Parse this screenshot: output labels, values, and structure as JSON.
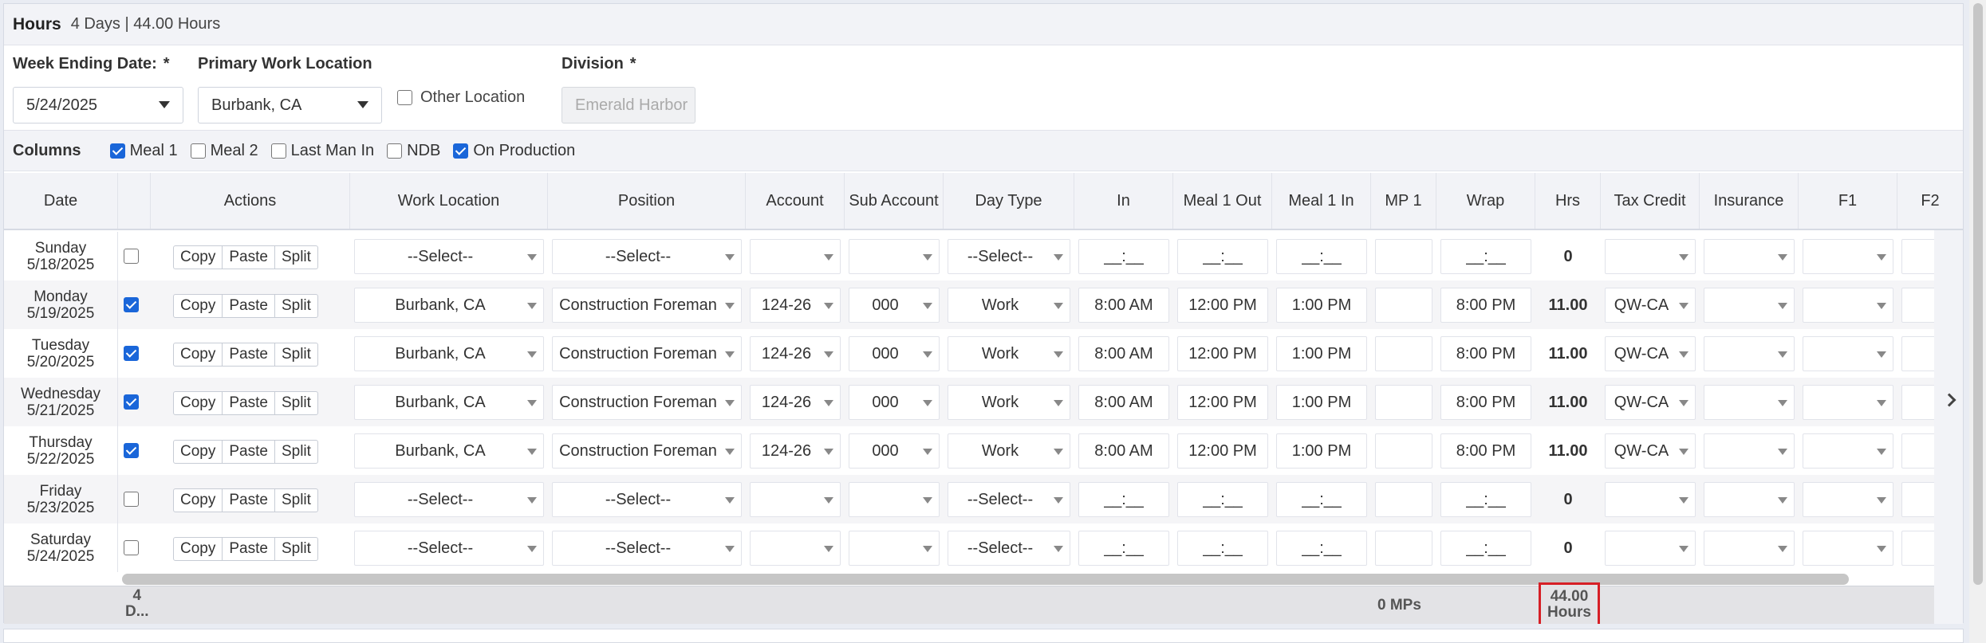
{
  "header": {
    "title": "Hours",
    "summary": "4 Days | 44.00 Hours"
  },
  "filters": {
    "week_ending_label": "Week Ending Date:",
    "week_ending_value": "5/24/2025",
    "primary_location_label": "Primary Work Location",
    "primary_location_value": "Burbank, CA",
    "other_location_label": "Other Location",
    "division_label": "Division",
    "division_value": "Emerald Harbor",
    "required_marker": "*"
  },
  "columns_bar": {
    "title": "Columns",
    "toggles": [
      {
        "label": "Meal 1",
        "checked": true
      },
      {
        "label": "Meal 2",
        "checked": false
      },
      {
        "label": "Last Man In",
        "checked": false
      },
      {
        "label": "NDB",
        "checked": false
      },
      {
        "label": "On Production",
        "checked": true
      }
    ]
  },
  "grid": {
    "headers": [
      "Date",
      "",
      "Actions",
      "Work Location",
      "Position",
      "Account",
      "Sub Account",
      "Day Type",
      "In",
      "Meal 1 Out",
      "Meal 1 In",
      "MP 1",
      "Wrap",
      "Hrs",
      "Tax Credit",
      "Insurance",
      "F1",
      "F2"
    ],
    "buttons": {
      "copy": "Copy",
      "paste": "Paste",
      "split": "Split"
    },
    "rows": [
      {
        "day": "Sunday",
        "date": "5/18/2025",
        "selected": false,
        "location": "--Select--",
        "position": "--Select--",
        "account": "",
        "sub_account": "",
        "day_type": "--Select--",
        "in": "__:__",
        "meal_out": "__:__",
        "meal_in": "__:__",
        "wrap": "__:__",
        "hrs": "0",
        "tax_credit": ""
      },
      {
        "day": "Monday",
        "date": "5/19/2025",
        "selected": true,
        "location": "Burbank, CA",
        "position": "Construction Foreman",
        "account": "124-26",
        "sub_account": "000",
        "day_type": "Work",
        "in": "8:00 AM",
        "meal_out": "12:00 PM",
        "meal_in": "1:00 PM",
        "wrap": "8:00 PM",
        "hrs": "11.00",
        "tax_credit": "QW-CA"
      },
      {
        "day": "Tuesday",
        "date": "5/20/2025",
        "selected": true,
        "location": "Burbank, CA",
        "position": "Construction Foreman",
        "account": "124-26",
        "sub_account": "000",
        "day_type": "Work",
        "in": "8:00 AM",
        "meal_out": "12:00 PM",
        "meal_in": "1:00 PM",
        "wrap": "8:00 PM",
        "hrs": "11.00",
        "tax_credit": "QW-CA"
      },
      {
        "day": "Wednesday",
        "date": "5/21/2025",
        "selected": true,
        "location": "Burbank, CA",
        "position": "Construction Foreman",
        "account": "124-26",
        "sub_account": "000",
        "day_type": "Work",
        "in": "8:00 AM",
        "meal_out": "12:00 PM",
        "meal_in": "1:00 PM",
        "wrap": "8:00 PM",
        "hrs": "11.00",
        "tax_credit": "QW-CA"
      },
      {
        "day": "Thursday",
        "date": "5/22/2025",
        "selected": true,
        "location": "Burbank, CA",
        "position": "Construction Foreman",
        "account": "124-26",
        "sub_account": "000",
        "day_type": "Work",
        "in": "8:00 AM",
        "meal_out": "12:00 PM",
        "meal_in": "1:00 PM",
        "wrap": "8:00 PM",
        "hrs": "11.00",
        "tax_credit": "QW-CA"
      },
      {
        "day": "Friday",
        "date": "5/23/2025",
        "selected": false,
        "location": "--Select--",
        "position": "--Select--",
        "account": "",
        "sub_account": "",
        "day_type": "--Select--",
        "in": "__:__",
        "meal_out": "__:__",
        "meal_in": "__:__",
        "wrap": "__:__",
        "hrs": "0",
        "tax_credit": ""
      },
      {
        "day": "Saturday",
        "date": "5/24/2025",
        "selected": false,
        "location": "--Select--",
        "position": "--Select--",
        "account": "",
        "sub_account": "",
        "day_type": "--Select--",
        "in": "__:__",
        "meal_out": "__:__",
        "meal_in": "__:__",
        "wrap": "__:__",
        "hrs": "0",
        "tax_credit": ""
      }
    ],
    "footer": {
      "days_line1": "4",
      "days_line2": "D...",
      "mps": "0 MPs",
      "total_line1": "44.00",
      "total_line2": "Hours"
    }
  },
  "icons": {
    "scroll_right": "chevron-right-icon",
    "dropdown": "caret-down-icon"
  },
  "colors": {
    "checkbox_checked": "#1a66d9",
    "total_highlight": "#d61f26"
  }
}
